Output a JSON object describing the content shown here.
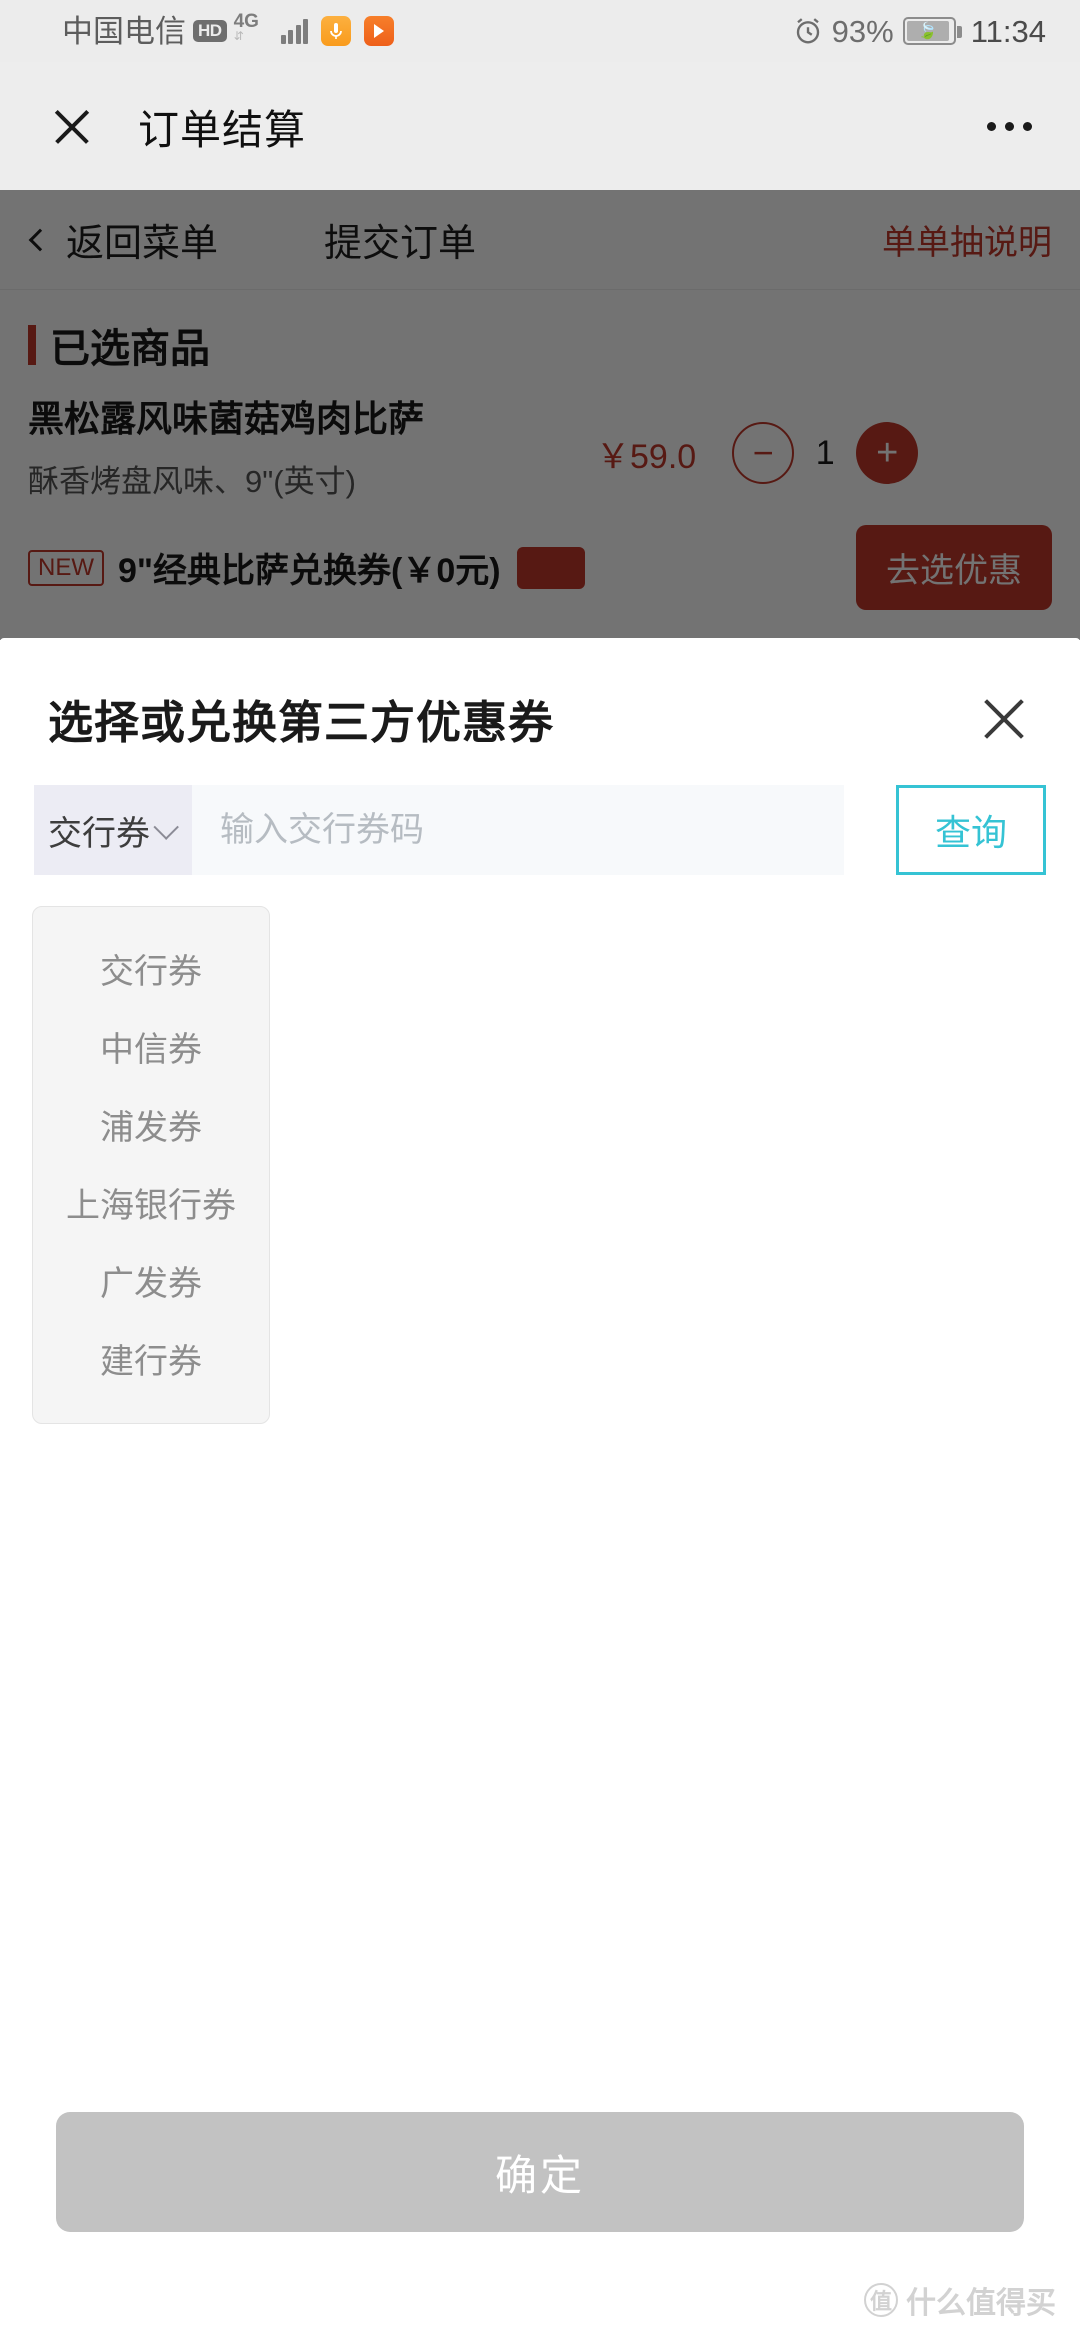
{
  "status_bar": {
    "carrier": "中国电信",
    "hd_badge": "HD",
    "network": "4G",
    "battery_percent": "93%",
    "time": "11:34",
    "icons": [
      "hd-icon",
      "signal-bars-icon",
      "app-badge-icon",
      "media-play-icon",
      "alarm-clock-icon",
      "battery-icon"
    ]
  },
  "wechat_nav": {
    "title": "订单结算",
    "close_label": "×",
    "more_label": "•••"
  },
  "page_behind": {
    "back_label": "返回菜单",
    "submit_label": "提交订单",
    "note_label": "单单抽说明",
    "section_title": "已选商品",
    "item": {
      "name": "黑松露风味菌菇鸡肉比萨",
      "desc": "酥香烤盘风味、9\"(英寸)",
      "price": "￥59.0",
      "qty": "1",
      "minus_label": "−",
      "plus_label": "+"
    },
    "row2": {
      "tag": "NEW",
      "text": "9\"经典比萨兑换券(￥0元)",
      "cta": "去选优惠"
    }
  },
  "sheet": {
    "title": "选择或兑换第三方优惠券",
    "close_label": "×",
    "selector": {
      "selected": "交行券",
      "options": [
        "交行券",
        "中信券",
        "浦发券",
        "上海银行券",
        "广发券",
        "建行券"
      ]
    },
    "code_input": {
      "value": "",
      "placeholder": "输入交行券码"
    },
    "query_button": "查询",
    "confirm_button": "确定"
  },
  "watermark": {
    "badge": "值",
    "text": "什么值得买"
  },
  "colors": {
    "accent_red": "#c0392b",
    "accent_cyan": "#35c3d4",
    "status_bg": "#ececec",
    "nav_bg": "#ededed",
    "disabled_gray": "#c2c2c2"
  }
}
